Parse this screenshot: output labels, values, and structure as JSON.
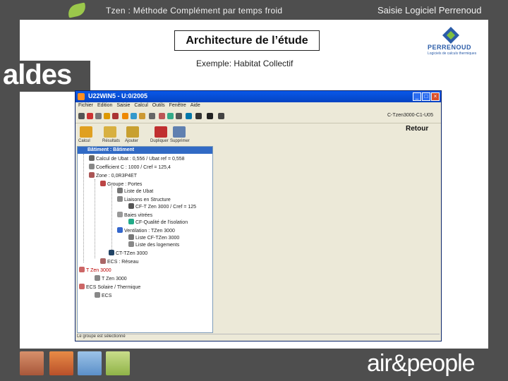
{
  "header": {
    "title": "Tzen : Méthode Complément par temps froid",
    "right_text": "Saisie Logiciel Perrenoud"
  },
  "brand": {
    "aldes": "aldes",
    "perrenoud": "PERRENOUD",
    "perrenoud_tagline": "Logiciels de calculs thermiques",
    "footer": "air&people",
    "accent_green": "#9bc84b",
    "dark_gray": "#4e4e4e"
  },
  "slide": {
    "title": "Architecture de l’étude",
    "subtitle": "Exemple: Habitat Collectif"
  },
  "app": {
    "window_title": "U22WIN5 - U:0/2005",
    "menu": [
      "Fichier",
      "Edition",
      "Saisie",
      "Calcul",
      "Outils",
      "Fenêtre",
      "Aide"
    ],
    "project": "C-Tzen3000-C1-U05",
    "big_buttons": [
      "Calcul",
      "Résultats",
      "Ajouter",
      "Dupliquer",
      "Supprimer"
    ],
    "retour": "Retour",
    "tree_header": "Bâtiment : Bâtiment",
    "tree": [
      "Calcul de Ubat : 0,556 / Ubat ref = 0,558",
      "Coefficient C : 1000 / Cref = 125,4",
      "Zone : 0,0R3P4ET",
      "Groupe : Portes",
      "Liste de Ubat",
      "Liaisons en Structure",
      "CF-T Zen 3000 / Cref = 125",
      "Baies vitrées",
      "CF-Qualité de l'isolation",
      "Ventilation : TZen 3000",
      "Liste CF-TZen 3000",
      "Liste des logements",
      "CT-TZen 3000",
      "ECS : Réseau",
      "T Zen 3000",
      "T Zen 3000",
      "ECS Solaire / Thermique",
      "ECS"
    ],
    "status": "Le groupe est sélectionné"
  }
}
